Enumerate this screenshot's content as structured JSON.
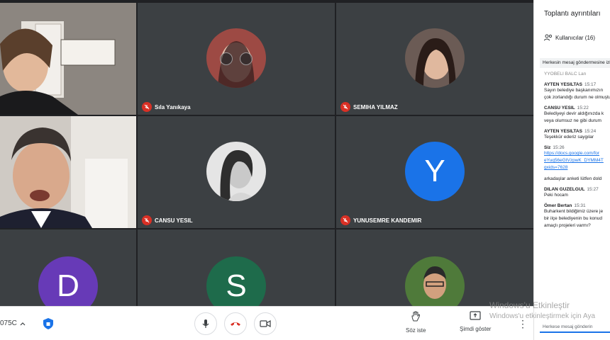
{
  "participants": [
    {
      "name": "Sıla Yanıkaya",
      "kind": "video"
    },
    {
      "name": "Sıla Yanıkaya",
      "kind": "avatar-image"
    },
    {
      "name": "SEMIHA YILMAZ",
      "kind": "avatar-image"
    },
    {
      "name": "",
      "kind": "video"
    },
    {
      "name": "CANSU YESIL",
      "kind": "avatar-image"
    },
    {
      "name": "YUNUSEMRE KANDEMIR",
      "kind": "letter",
      "letter": "Y",
      "color": "#1a73e8"
    },
    {
      "name": "",
      "kind": "letter",
      "letter": "D",
      "color": "#673ab7"
    },
    {
      "name": "",
      "kind": "letter",
      "letter": "S",
      "color": "#1e6b4b"
    },
    {
      "name": "",
      "kind": "avatar-image"
    }
  ],
  "bottom_bar": {
    "meeting_code": "075C",
    "raise_hand_label": "Söz iste",
    "present_label": "Şimdi göster"
  },
  "panel": {
    "title": "Toplantı ayrıntıları",
    "users_label": "Kullanıcılar (16)",
    "everyone_message_toggle": "Herkesin mesaj göndermesine izin ver",
    "input_placeholder": "Herkese mesaj gönderin"
  },
  "messages": [
    {
      "sender": "",
      "time": "",
      "lines": [
        "YYOBELI BALC Lan"
      ]
    },
    {
      "sender": "AYTEN YESILTAS",
      "time": "15:17",
      "lines": [
        "Sayın belediye başkanımızın",
        "çok zorlandığı durum ne olmuştur"
      ]
    },
    {
      "sender": "CANSU YESIL",
      "time": "15:22",
      "lines": [
        "Belediyeyi devir aldığınızda k",
        "veya olumsuz ne gibi durum"
      ]
    },
    {
      "sender": "AYTEN YESILTAS",
      "time": "15:24",
      "lines": [
        "Teşekkür ederiz saygılar"
      ]
    },
    {
      "sender": "Siz",
      "time": "15:26",
      "lines": [
        "https://docs.google.com/for",
        "eYuq56eGtVzpwK_DYMM4T",
        "gxids=7628"
      ],
      "link": true
    },
    {
      "sender": "",
      "time": "",
      "lines": [
        "arkadaşlar anketi lütfen dold"
      ]
    },
    {
      "sender": "DILAN GUZELGUL",
      "time": "15:27",
      "lines": [
        "Peki hocam"
      ]
    },
    {
      "sender": "Ömer Bertan",
      "time": "15:31",
      "lines": [
        "Buharkent bildiğimiz üzere je",
        "bir ilçe belediyenin bu konud",
        "amaçlı projeleri varmı?"
      ]
    }
  ],
  "watermark": {
    "line1": "Windows'u Etkinleştir",
    "line2": "Windows'u etkinleştirmek için Aya"
  },
  "colors": {
    "mute_red": "#d93025",
    "link_blue": "#1a73e8",
    "tile_bg": "#3c4043",
    "grid_bg": "#202124"
  }
}
